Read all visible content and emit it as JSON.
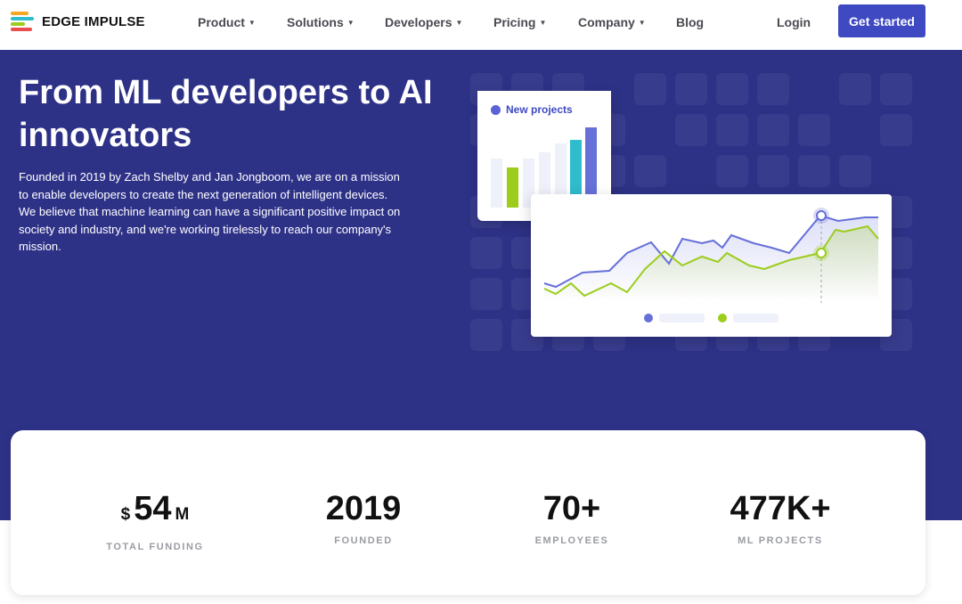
{
  "nav": {
    "brand": "EDGE IMPULSE",
    "items": [
      {
        "label": "Product",
        "caret": true
      },
      {
        "label": "Solutions",
        "caret": true
      },
      {
        "label": "Developers",
        "caret": true
      },
      {
        "label": "Pricing",
        "caret": true
      },
      {
        "label": "Company",
        "caret": true
      },
      {
        "label": "Blog",
        "caret": false
      }
    ],
    "login": "Login",
    "cta": "Get started"
  },
  "hero": {
    "title": "From ML developers to AI innovators",
    "description": "Founded in 2019 by Zach Shelby and Jan Jongboom, we are on a mission to enable developers to create the next generation of intelligent devices. We believe that machine learning can have a significant positive impact on society and industry, and we're working tirelessly to reach our company's mission."
  },
  "illustration": {
    "card_label": "New projects",
    "colors": {
      "blue": "#6670d8",
      "green": "#9ccc1c",
      "teal": "#2fbccc",
      "pale": "#eef0fa"
    }
  },
  "stats": [
    {
      "prefix": "$",
      "value": "54",
      "suffix": "M",
      "label": "TOTAL FUNDING"
    },
    {
      "prefix": "",
      "value": "2019",
      "suffix": "",
      "label": "FOUNDED"
    },
    {
      "prefix": "",
      "value": "70+",
      "suffix": "",
      "label": "EMPLOYEES"
    },
    {
      "prefix": "",
      "value": "477K+",
      "suffix": "",
      "label": "ML PROJECTS"
    }
  ],
  "colors": {
    "brand_blue": "#3e49c2",
    "hero_bg": "#2e3287"
  }
}
